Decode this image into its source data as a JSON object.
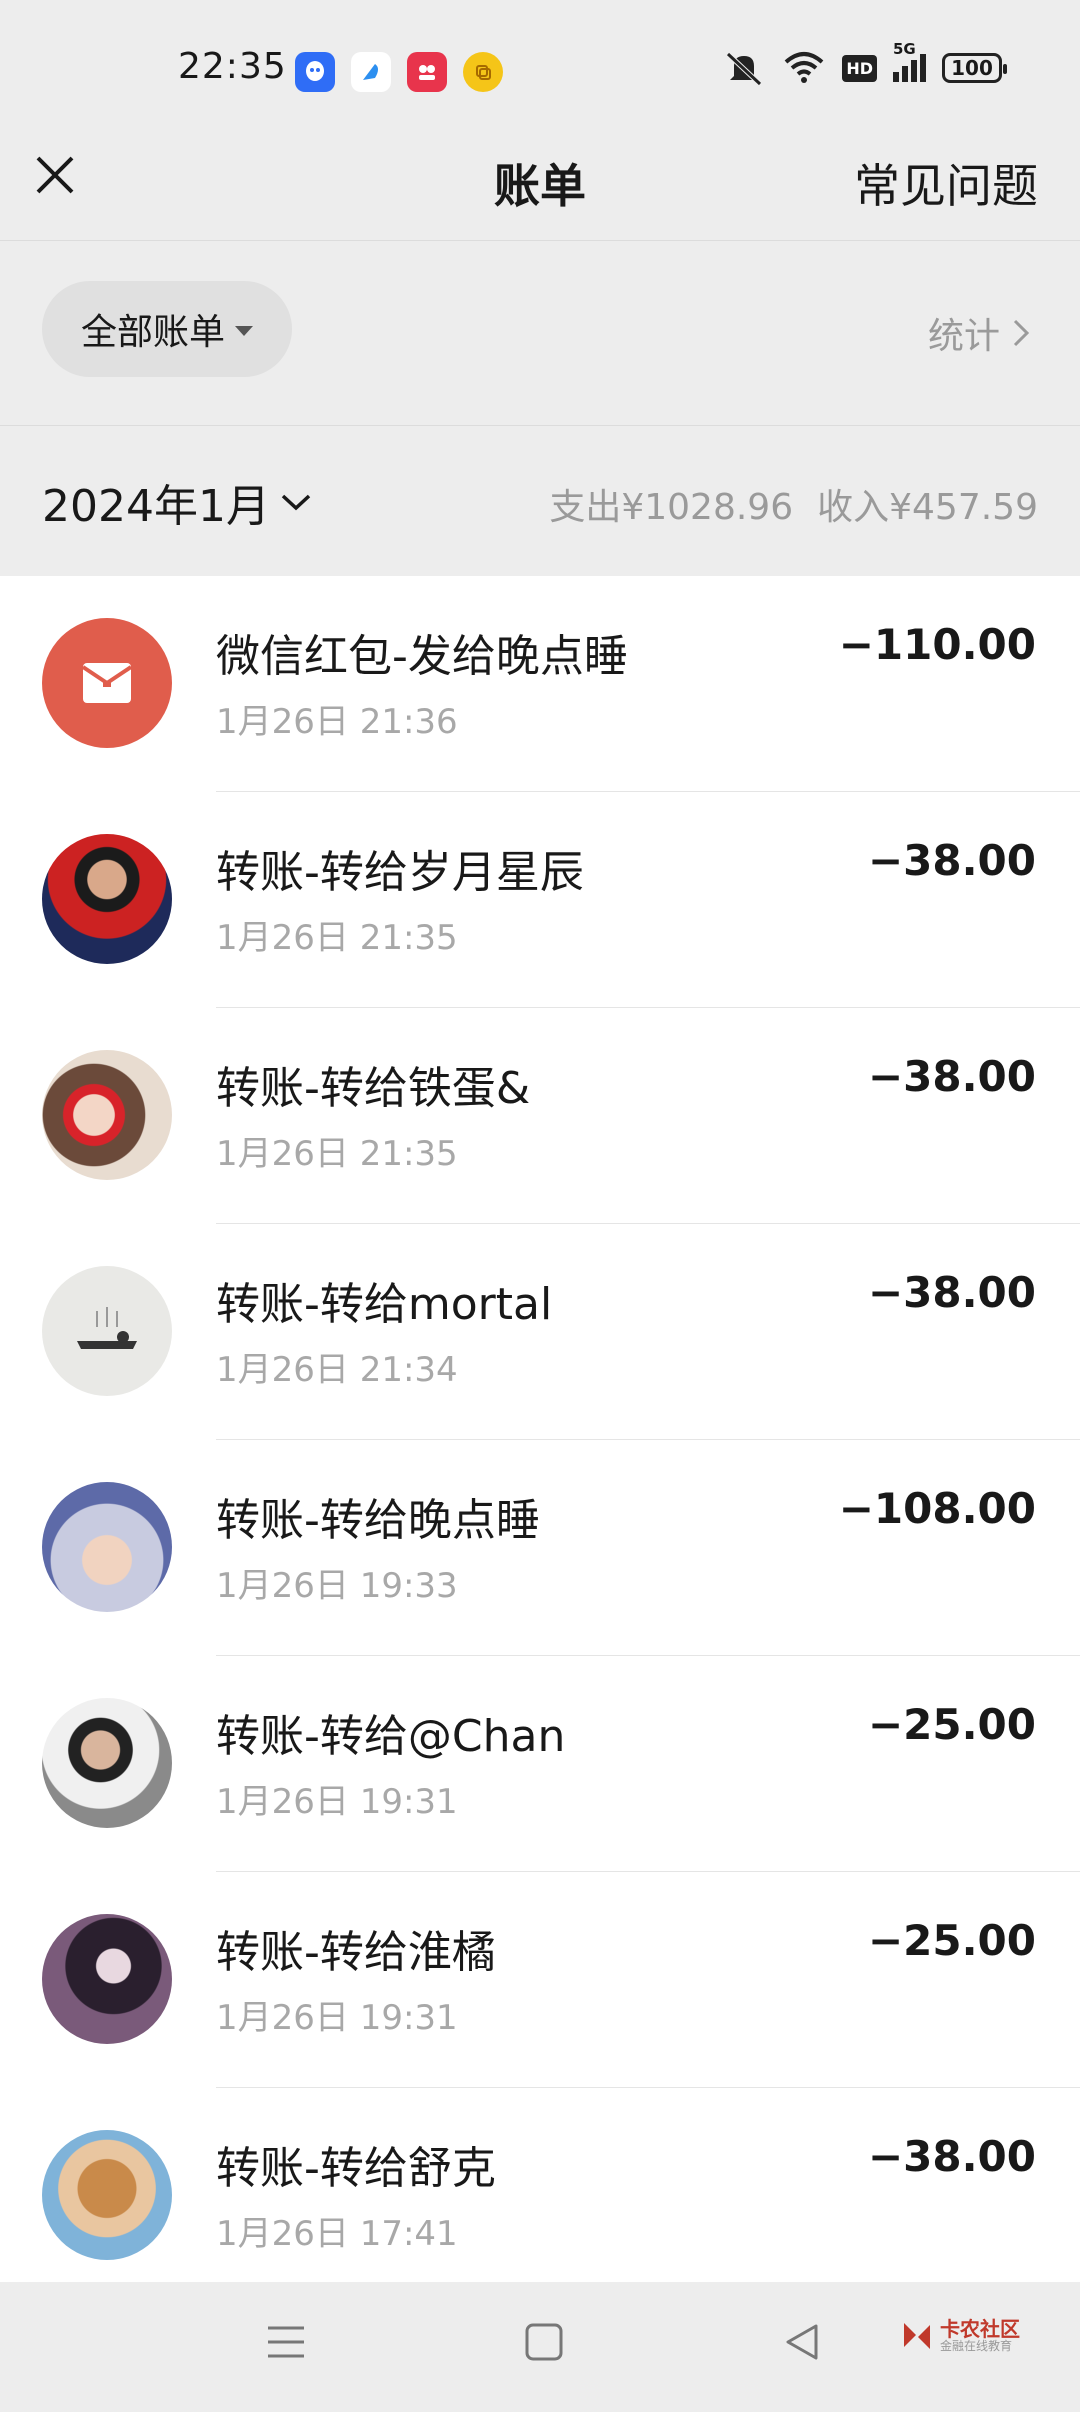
{
  "status": {
    "time": "22:35",
    "battery": "100",
    "network": "5G",
    "hd": "HD"
  },
  "header": {
    "title": "账单",
    "faq": "常见问题"
  },
  "filter": {
    "all_bills": "全部账单",
    "stats": "统计"
  },
  "month": {
    "label": "2024年1月",
    "expense": "支出¥1028.96",
    "income": "收入¥457.59"
  },
  "transactions": [
    {
      "title": "微信红包-发给晚点睡",
      "date": "1月26日 21:36",
      "amount": "−110.00"
    },
    {
      "title": "转账-转给岁月星辰",
      "date": "1月26日 21:35",
      "amount": "−38.00"
    },
    {
      "title": "转账-转给铁蛋&",
      "date": "1月26日 21:35",
      "amount": "−38.00"
    },
    {
      "title": "转账-转给mortal",
      "date": "1月26日 21:34",
      "amount": "−38.00"
    },
    {
      "title": "转账-转给晚点睡",
      "date": "1月26日 19:33",
      "amount": "−108.00"
    },
    {
      "title": "转账-转给@Chan",
      "date": "1月26日 19:31",
      "amount": "−25.00"
    },
    {
      "title": "转账-转给淮橘",
      "date": "1月26日 19:31",
      "amount": "−25.00"
    },
    {
      "title": "转账-转给舒克",
      "date": "1月26日 17:41",
      "amount": "−38.00"
    }
  ],
  "watermark": {
    "title": "卡农社区",
    "subtitle": "金融在线教育"
  },
  "colors": {
    "red_packet": "#e05d4c",
    "background": "#ededed",
    "list_bg": "#ffffff"
  }
}
